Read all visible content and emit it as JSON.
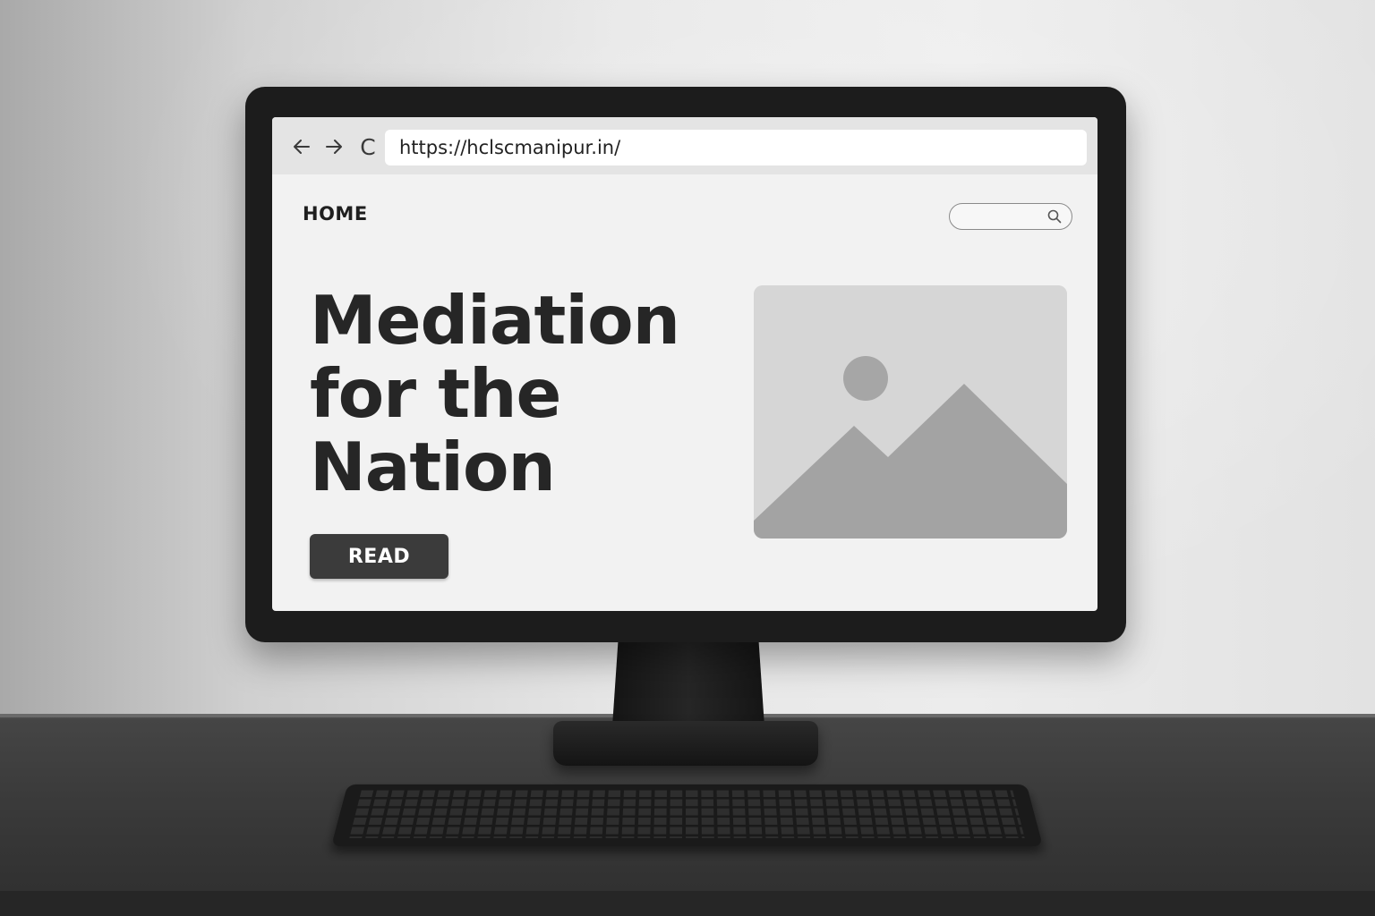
{
  "browser": {
    "url": "https://hclscmanipur.in/",
    "back_icon": "arrow-left-icon",
    "forward_icon": "arrow-right-icon",
    "reload_label": "C"
  },
  "page": {
    "nav_home": "HOME",
    "search_icon": "search-icon",
    "headline_line1": "Mediation",
    "headline_line2": "for the Nation",
    "read_button": "READ",
    "image_icon": "image-placeholder-icon"
  },
  "colors": {
    "screen_bg": "#f2f2f2",
    "button_bg": "#3b3b3b",
    "text_dark": "#262626"
  }
}
